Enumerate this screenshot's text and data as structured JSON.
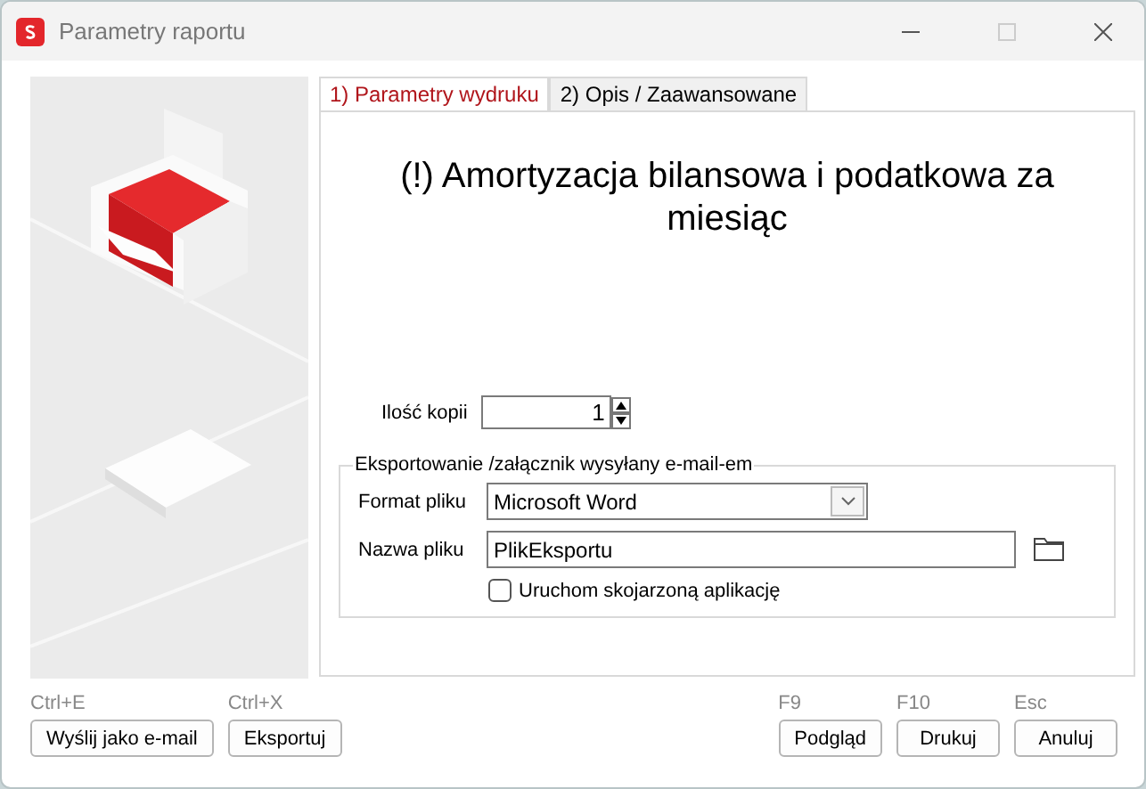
{
  "window": {
    "title": "Parametry raportu"
  },
  "tabs": [
    {
      "label": "1) Parametry wydruku",
      "selected": true
    },
    {
      "label": "2) Opis / Zaawansowane",
      "selected": false
    }
  ],
  "report_title": "(!) Amortyzacja bilansowa i podatkowa za miesiąc",
  "copies": {
    "label": "Ilość kopii",
    "value": "1"
  },
  "export_group": {
    "title": "Eksportowanie /załącznik wysyłany e-mail-em",
    "format": {
      "label": "Format pliku",
      "value": "Microsoft Word"
    },
    "filename": {
      "label": "Nazwa pliku",
      "value": "PlikEksportu"
    },
    "open_app": {
      "label": "Uruchom skojarzoną aplikację",
      "checked": false
    }
  },
  "buttons_left": [
    {
      "shortcut": "Ctrl+E",
      "label": "Wyślij jako e-mail"
    },
    {
      "shortcut": "Ctrl+X",
      "label": "Eksportuj"
    }
  ],
  "buttons_right": [
    {
      "shortcut": "F9",
      "label": "Podgląd"
    },
    {
      "shortcut": "F10",
      "label": "Drukuj"
    },
    {
      "shortcut": "Esc",
      "label": "Anuluj"
    }
  ]
}
